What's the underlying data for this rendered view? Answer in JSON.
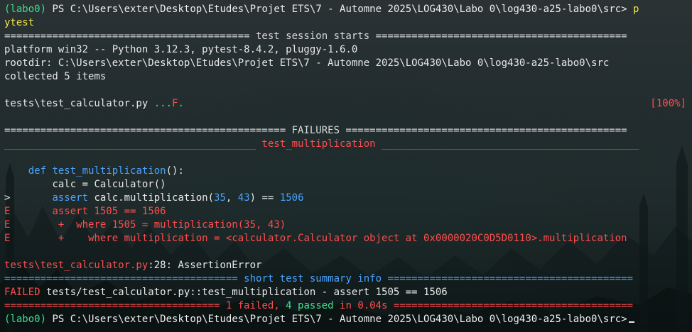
{
  "terminal": {
    "prompt_env": "(labo0)",
    "prompt_path": "PS C:\\Users\\exter\\Desktop\\Etudes\\Projet ETS\\7 - Automne 2025\\LOG430\\Labo 0\\log430-a25-labo0\\src>",
    "command_part1": "p",
    "command_part2": "ytest",
    "session_header": "========================================= test session starts ==========================================",
    "platform_line": "platform win32 -- Python 3.12.3, pytest-8.4.2, pluggy-1.6.0",
    "rootdir_line": "rootdir: C:\\Users\\exter\\Desktop\\Etudes\\Projet ETS\\7 - Automne 2025\\LOG430\\Labo 0\\log430-a25-labo0\\src",
    "collected_line": "collected 5 items",
    "test_file": "tests\\test_calculator.py",
    "test_dots": "...",
    "test_fail_marker": "F",
    "test_fail_dot": ".",
    "test_percent": "[100%]",
    "failures_header": "=============================================== FAILURES ===============================================",
    "fail_test_header": "__________________________________________ test_multiplication ___________________________________________",
    "code_def_keyword": "def",
    "code_def_name": "test_multiplication",
    "code_def_rest": "():",
    "code_calc": "calc = Calculator()",
    "code_marker_gt": ">",
    "code_assert_kw": "assert",
    "code_assert_body1": "calc.multiplication(",
    "code_assert_n1": "35",
    "code_assert_comma": ", ",
    "code_assert_n2": "43",
    "code_assert_body2": ") ==",
    "code_assert_n3": "1506",
    "err_marker": "E",
    "err_line1": "assert 1505 == 1506",
    "err_line2": " +  where 1505 = multiplication(35, 43)",
    "err_line3": " +    where multiplication = <calculator.Calculator object at 0x0000020C0D5D0110>.multiplication",
    "trace_file": "tests\\test_calculator.py",
    "trace_rest": ":28: AssertionError",
    "summary_header_left": "======================================= ",
    "summary_header_text": "short test summary info",
    "summary_header_right": " =========================================",
    "failed_label": "FAILED",
    "failed_rest": "tests/test_calculator.py::test_multiplication - assert 1505 == 1506",
    "result_left": "==================================== ",
    "result_failed": "1 failed",
    "result_comma": ", ",
    "result_passed": "4 passed",
    "result_in": " in 0.04s",
    "result_right": " ========================================",
    "final_prompt_env": "(labo0)",
    "final_prompt_path": "PS C:\\Users\\exter\\Desktop\\Etudes\\Projet ETS\\7 - Automne 2025\\LOG430\\Labo 0\\log430-a25-labo0\\src>"
  },
  "colors": {
    "background": "#1b2224",
    "text": "#e8e8e8",
    "env": "#f5e84a",
    "pass": "#3fe08a",
    "fail": "#ff4d4d",
    "keyword": "#4aa3ff"
  }
}
